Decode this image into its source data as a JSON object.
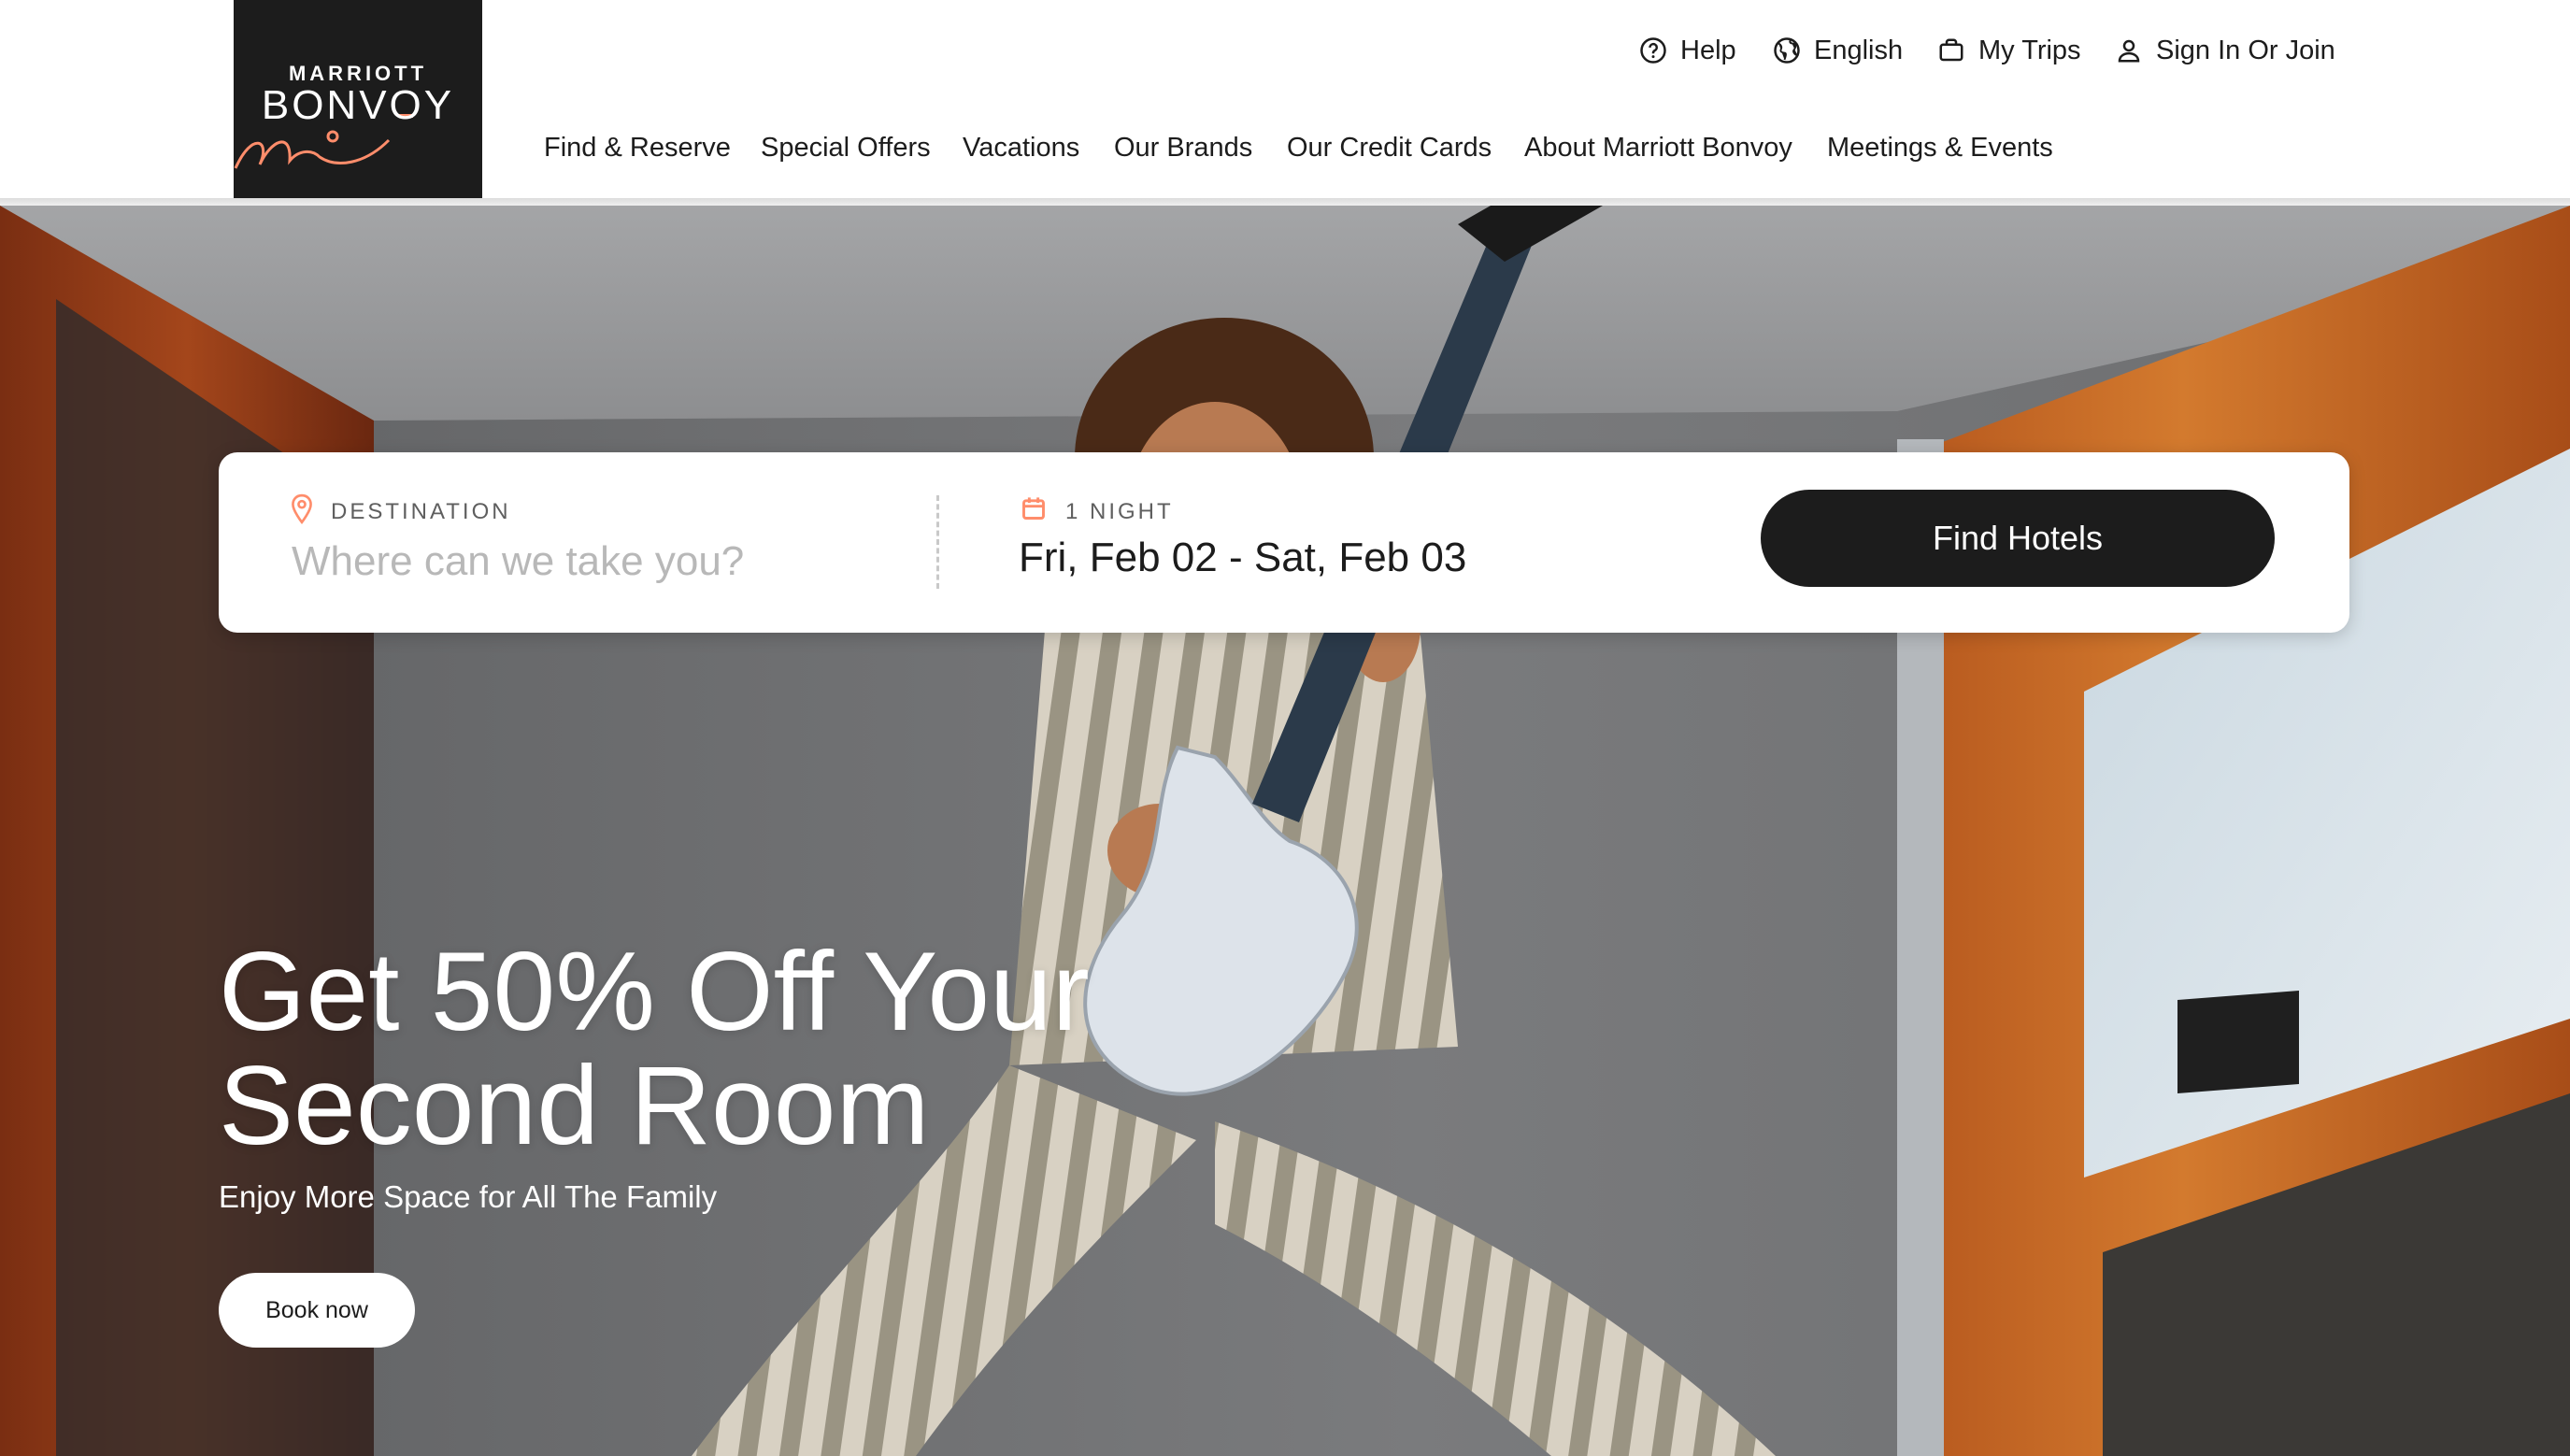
{
  "brand": {
    "line1": "MARRIOTT",
    "line2": "BONVOY",
    "accent_color": "#ff8d6b",
    "logo_bg": "#1c1c1c"
  },
  "utility_nav": {
    "help": "Help",
    "language": "English",
    "trips": "My Trips",
    "sign_in": "Sign In Or Join"
  },
  "main_nav": [
    {
      "label": "Find & Reserve"
    },
    {
      "label": "Special Offers"
    },
    {
      "label": "Vacations"
    },
    {
      "label": "Our Brands"
    },
    {
      "label": "Our Credit Cards"
    },
    {
      "label": "About Marriott Bonvoy"
    },
    {
      "label": "Meetings & Events"
    }
  ],
  "search": {
    "destination_label": "DESTINATION",
    "destination_placeholder": "Where can we take you?",
    "destination_value": "",
    "nights_label": "1 NIGHT",
    "dates": "Fri, Feb 02 - Sat, Feb 03",
    "find_button": "Find Hotels"
  },
  "hero": {
    "headline_line1": "Get 50% Off Your",
    "headline_line2": "Second Room",
    "subheading": "Enjoy More Space for All The Family",
    "cta": "Book now"
  },
  "icons": {
    "help": "help-circle-icon",
    "language": "globe-icon",
    "trips": "briefcase-icon",
    "account": "user-icon",
    "destination": "map-pin-icon",
    "dates": "calendar-icon"
  }
}
